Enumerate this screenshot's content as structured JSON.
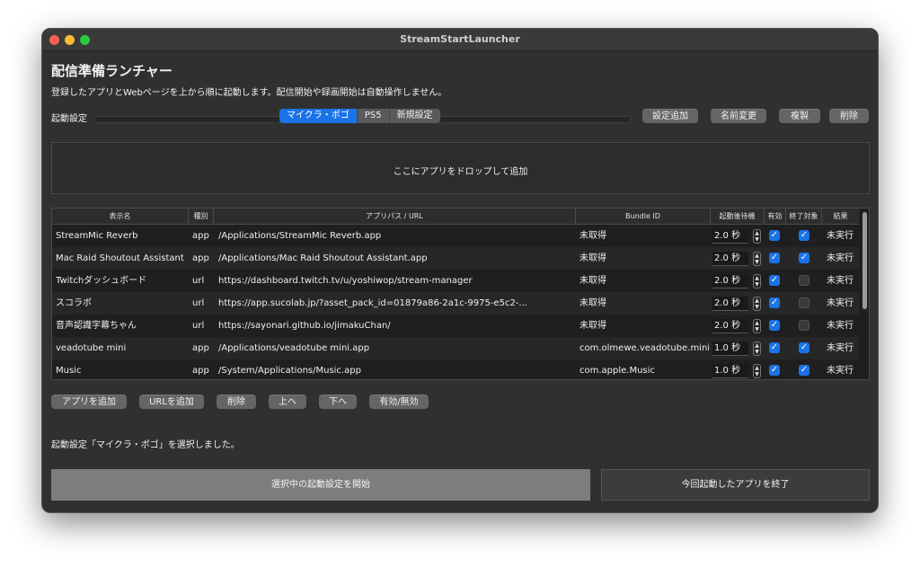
{
  "window": {
    "title": "StreamStartLauncher"
  },
  "header": {
    "title": "配信準備ランチャー",
    "subtitle": "登録したアプリとWebページを上から順に起動します。配信開始や録画開始は自動操作しません。"
  },
  "profile": {
    "label": "起動設定",
    "tabs": [
      "マイクラ・ポゴ",
      "PS5",
      "新規設定"
    ],
    "selected": "マイクラ・ポゴ",
    "buttons": {
      "add": "設定追加",
      "rename": "名前変更",
      "duplicate": "複製",
      "delete": "削除"
    }
  },
  "dropzone": {
    "text": "ここにアプリをドロップして追加"
  },
  "table": {
    "headers": [
      "表示名",
      "種別",
      "アプリパス / URL",
      "Bundle ID",
      "起動後待機",
      "有効",
      "終了対象",
      "結果"
    ],
    "rows": [
      {
        "name": "StreamMic Reverb",
        "type": "app",
        "path": "/Applications/StreamMic Reverb.app",
        "bundle": "未取得",
        "delay": "2.0 秒",
        "enabled": true,
        "quit": true,
        "result": "未実行"
      },
      {
        "name": "Mac Raid Shoutout Assistant",
        "type": "app",
        "path": "/Applications/Mac Raid Shoutout Assistant.app",
        "bundle": "未取得",
        "delay": "2.0 秒",
        "enabled": true,
        "quit": true,
        "result": "未実行"
      },
      {
        "name": "Twitchダッシュボード",
        "type": "url",
        "path": "https://dashboard.twitch.tv/u/yoshiwop/stream-manager",
        "bundle": "未取得",
        "delay": "2.0 秒",
        "enabled": true,
        "quit": false,
        "result": "未実行"
      },
      {
        "name": "スコラボ",
        "type": "url",
        "path": "https://app.sucolab.jp/?asset_pack_id=01879a86-2a1c-9975-e5c2-...",
        "bundle": "未取得",
        "delay": "2.0 秒",
        "enabled": true,
        "quit": false,
        "result": "未実行"
      },
      {
        "name": "音声認識字幕ちゃん",
        "type": "url",
        "path": "https://sayonari.github.io/jimakuChan/",
        "bundle": "未取得",
        "delay": "2.0 秒",
        "enabled": true,
        "quit": false,
        "result": "未実行"
      },
      {
        "name": "veadotube mini",
        "type": "app",
        "path": "/Applications/veadotube mini.app",
        "bundle": "com.olmewe.veadotube.mini",
        "delay": "1.0 秒",
        "enabled": true,
        "quit": true,
        "result": "未実行"
      },
      {
        "name": "Music",
        "type": "app",
        "path": "/System/Applications/Music.app",
        "bundle": "com.apple.Music",
        "delay": "1.0 秒",
        "enabled": true,
        "quit": true,
        "result": "未実行"
      }
    ]
  },
  "actions": {
    "add_app": "アプリを追加",
    "add_url": "URLを追加",
    "delete": "削除",
    "up": "上へ",
    "down": "下へ",
    "toggle": "有効/無効"
  },
  "status": "起動設定「マイクラ・ポゴ」を選択しました。",
  "footer": {
    "start": "選択中の起動設定を開始",
    "quit": "今回起動したアプリを終了"
  },
  "colors": {
    "accent": "#1a73e8",
    "window_bg": "#303030"
  },
  "icons": {
    "checkbox": "checkmark-icon",
    "stepper": "stepper-icon"
  }
}
